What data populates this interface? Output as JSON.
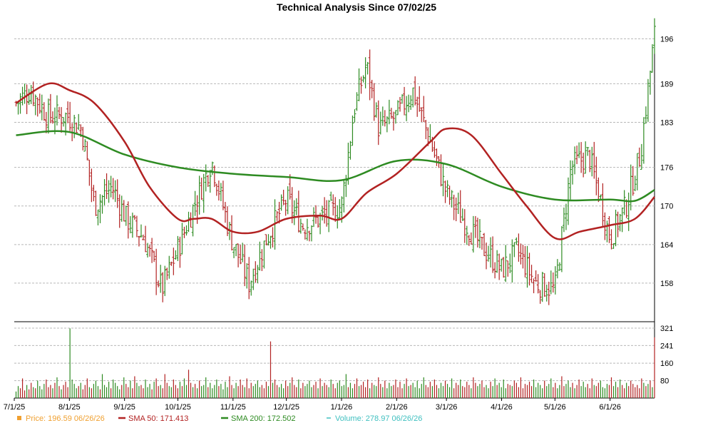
{
  "chart_data": {
    "type": "line",
    "title": "Technical Analysis Since 07/02/25",
    "price_panel": {
      "y_ticks": [
        158,
        164,
        170,
        176,
        183,
        189,
        196
      ],
      "ylim": [
        152,
        196.59
      ],
      "price_close": [
        [
          "7/2/25",
          186
        ],
        [
          "7/10/25",
          188
        ],
        [
          "7/20/25",
          184
        ],
        [
          "7/31/25",
          184
        ],
        [
          "8/8/25",
          182
        ],
        [
          "8/15/25",
          170
        ],
        [
          "8/25/25",
          173
        ],
        [
          "9/2/25",
          168
        ],
        [
          "9/12/25",
          165
        ],
        [
          "9/22/25",
          157
        ],
        [
          "10/2/25",
          164
        ],
        [
          "10/10/25",
          170
        ],
        [
          "10/20/25",
          177
        ],
        [
          "10/31/25",
          165
        ],
        [
          "11/10/25",
          158
        ],
        [
          "11/20/25",
          165
        ],
        [
          "12/1/25",
          171
        ],
        [
          "12/10/25",
          167
        ],
        [
          "12/20/25",
          168
        ],
        [
          "1/1/26",
          170
        ],
        [
          "1/8/26",
          185
        ],
        [
          "1/15/26",
          192
        ],
        [
          "1/22/26",
          182
        ],
        [
          "2/1/26",
          184
        ],
        [
          "2/10/26",
          188
        ],
        [
          "2/20/26",
          180
        ],
        [
          "3/1/26",
          172
        ],
        [
          "3/10/26",
          168
        ],
        [
          "3/20/26",
          164
        ],
        [
          "4/1/26",
          160
        ],
        [
          "4/10/26",
          163
        ],
        [
          "4/20/26",
          158
        ],
        [
          "5/1/26",
          157
        ],
        [
          "5/10/26",
          176
        ],
        [
          "5/20/26",
          178
        ],
        [
          "6/1/26",
          165
        ],
        [
          "6/10/26",
          170
        ],
        [
          "6/18/26",
          178
        ],
        [
          "6/26/26",
          196.59
        ]
      ],
      "sma50": [
        [
          "7/2/25",
          186
        ],
        [
          "7/20/25",
          189
        ],
        [
          "8/1/25",
          188
        ],
        [
          "8/15/25",
          186
        ],
        [
          "9/1/25",
          180
        ],
        [
          "9/15/25",
          173
        ],
        [
          "10/1/25",
          168
        ],
        [
          "10/10/25",
          168
        ],
        [
          "10/20/25",
          168
        ],
        [
          "11/1/25",
          166
        ],
        [
          "11/15/25",
          166
        ],
        [
          "12/1/25",
          168
        ],
        [
          "12/20/25",
          168.5
        ],
        [
          "1/1/26",
          168
        ],
        [
          "1/15/26",
          172
        ],
        [
          "2/1/26",
          175
        ],
        [
          "2/20/26",
          180
        ],
        [
          "3/1/26",
          182
        ],
        [
          "3/15/26",
          181
        ],
        [
          "4/1/26",
          175
        ],
        [
          "4/15/26",
          170
        ],
        [
          "5/1/26",
          165
        ],
        [
          "5/15/26",
          166
        ],
        [
          "6/1/26",
          167
        ],
        [
          "6/15/26",
          168
        ],
        [
          "6/26/26",
          171.413
        ]
      ],
      "sma200": [
        [
          "7/2/25",
          181
        ],
        [
          "8/1/25",
          181.5
        ],
        [
          "9/1/25",
          178
        ],
        [
          "10/1/25",
          176
        ],
        [
          "11/1/25",
          175
        ],
        [
          "12/1/25",
          174.5
        ],
        [
          "1/1/26",
          174
        ],
        [
          "2/1/26",
          177
        ],
        [
          "3/1/26",
          176.5
        ],
        [
          "4/1/26",
          173
        ],
        [
          "5/1/26",
          171
        ],
        [
          "6/1/26",
          171
        ],
        [
          "6/15/26",
          170.8
        ],
        [
          "6/26/26",
          172.502
        ]
      ]
    },
    "volume_panel": {
      "y_ticks": [
        80,
        160,
        241,
        321
      ],
      "ylim": [
        0,
        321
      ],
      "values": [
        30,
        55,
        45,
        90,
        35,
        60,
        40,
        70,
        50,
        45,
        80,
        55,
        40,
        65,
        85,
        50,
        60,
        45,
        70,
        95,
        55,
        40,
        60,
        75,
        50,
        320,
        85,
        65,
        45,
        55,
        70,
        40,
        60,
        90,
        50,
        45,
        65,
        80,
        55,
        40,
        110,
        60,
        50,
        75,
        45,
        85,
        70,
        55,
        40,
        60,
        95,
        65,
        50,
        80,
        45,
        100,
        70,
        55,
        60,
        45,
        85,
        50,
        65,
        40,
        75,
        90,
        55,
        60,
        45,
        110,
        70,
        55,
        50,
        85,
        60,
        45,
        75,
        55,
        90,
        60,
        130,
        70,
        50,
        65,
        45,
        80,
        55,
        60,
        95,
        50,
        70,
        45,
        60,
        85,
        55,
        65,
        40,
        75,
        50,
        100,
        60,
        45,
        70,
        55,
        85,
        60,
        50,
        90,
        45,
        70,
        55,
        65,
        80,
        50,
        60,
        45,
        75,
        55,
        260,
        70,
        85,
        60,
        50,
        65,
        45,
        80,
        55,
        70,
        95,
        60,
        50,
        85,
        45,
        70,
        55,
        65,
        80,
        50,
        60,
        75,
        45,
        90,
        55,
        70,
        60,
        50,
        85,
        65,
        45,
        70,
        80,
        55,
        60,
        110,
        50,
        70,
        45,
        65,
        90,
        55,
        60,
        75,
        50,
        85,
        45,
        70,
        60,
        55,
        95,
        65,
        50,
        80,
        45,
        70,
        55,
        60,
        85,
        50,
        75,
        45,
        65,
        90,
        55,
        60,
        70,
        50,
        80,
        45,
        65,
        95,
        60,
        50,
        75,
        55,
        85,
        60,
        45,
        70,
        55,
        80,
        65,
        50,
        90,
        45,
        70,
        60,
        85,
        55,
        50,
        75,
        60,
        45,
        95,
        70,
        55,
        65,
        80,
        50,
        60,
        45,
        75,
        55,
        90,
        60,
        70,
        50,
        85,
        45,
        65,
        60,
        55,
        80,
        70,
        50,
        95,
        45,
        65,
        60,
        75,
        55,
        85,
        50,
        70,
        60,
        45,
        80,
        55,
        65,
        90,
        50,
        70,
        45,
        60,
        100,
        55,
        65,
        80,
        50,
        70,
        45,
        60,
        85,
        55,
        75,
        50,
        65,
        45,
        90,
        60,
        55,
        70,
        80,
        50,
        45,
        65,
        60,
        95,
        55,
        75,
        50,
        85,
        60,
        45,
        70,
        55,
        80,
        65,
        50,
        60,
        45,
        90,
        70,
        55,
        65,
        80,
        50,
        278.97
      ]
    },
    "x_ticks": [
      "7/1/25",
      "8/1/25",
      "9/1/25",
      "10/1/25",
      "11/1/25",
      "12/1/25",
      "1/1/26",
      "2/1/26",
      "3/1/26",
      "4/1/26",
      "5/1/26",
      "6/1/26"
    ],
    "legend": [
      {
        "label": "Price: 196.59  06/26/26",
        "color": "#f0a030",
        "marker": "square"
      },
      {
        "label": "SMA 50: 171.413",
        "color": "#b22222",
        "marker": "line"
      },
      {
        "label": "SMA 200: 172.502",
        "color": "#2e8b22",
        "marker": "line"
      },
      {
        "label": "Volume: 278.97  06/26/26",
        "color": "#40c0c0",
        "marker": "dash"
      }
    ],
    "colors": {
      "up": "#2e8b22",
      "down": "#b22222",
      "grid": "#b8b8b8",
      "sma50": "#b22222",
      "sma200": "#2e8b22"
    }
  }
}
